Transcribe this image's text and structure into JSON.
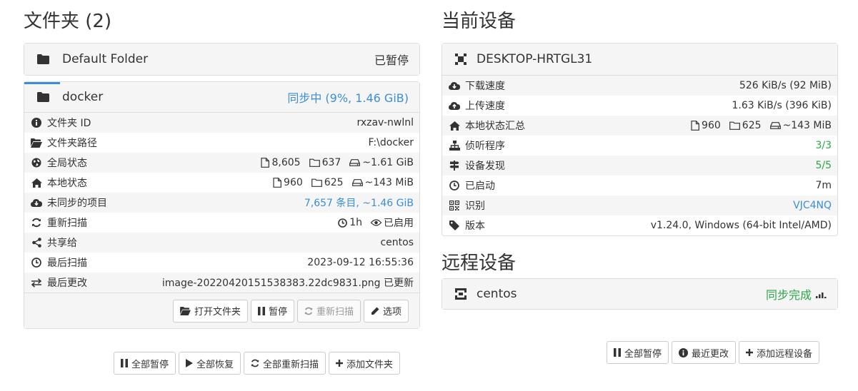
{
  "left": {
    "title": "文件夹 (2)",
    "folders": [
      {
        "name": "Default Folder",
        "status": "已暂停",
        "icon": "folder-icon"
      },
      {
        "name": "docker",
        "status": "同步中 (9%, 1.46 GiB)",
        "icon": "folder-icon",
        "progress_fraction": 0.09
      }
    ],
    "details": [
      {
        "icon": "info-icon",
        "label": "文件夹 ID",
        "value": "rxzav-nwlnl"
      },
      {
        "icon": "folder-open-icon",
        "label": "文件夹路径",
        "value": "F:\\docker"
      },
      {
        "icon": "globe-icon",
        "label": "全局状态",
        "files": "8,605",
        "dirs": "637",
        "size": "~1.61 GiB"
      },
      {
        "icon": "home-icon",
        "label": "本地状态",
        "files": "960",
        "dirs": "625",
        "size": "~143 MiB"
      },
      {
        "icon": "cloud-download-icon",
        "label": "未同步的项目",
        "value": "7,657 条目, ~1.46 GiB"
      },
      {
        "icon": "refresh-icon",
        "label": "重新扫描",
        "interval": "1h",
        "watch": "已启用"
      },
      {
        "icon": "share-icon",
        "label": "共享给",
        "value": "centos"
      },
      {
        "icon": "clock-icon",
        "label": "最后扫描",
        "value": "2023-09-12 16:55:36"
      },
      {
        "icon": "exchange-icon",
        "label": "最后更改",
        "value": "image-20220420151538383.22dc9831.png 已更新"
      }
    ],
    "footer_buttons": {
      "open": "打开文件夹",
      "pause": "暂停",
      "rescan": "重新扫描",
      "options": "选项"
    },
    "bottom_buttons": {
      "pause_all": "全部暂停",
      "resume_all": "全部恢复",
      "rescan_all": "全部重新扫描",
      "add_folder": "添加文件夹"
    }
  },
  "right": {
    "title": "当前设备",
    "device_name": "DESKTOP-HRTGL31",
    "details": [
      {
        "icon": "cloud-download-icon",
        "label": "下载速度",
        "value": "526 KiB/s (92 MiB)"
      },
      {
        "icon": "cloud-upload-icon",
        "label": "上传速度",
        "value": "1.63 KiB/s (396 KiB)"
      },
      {
        "icon": "home-icon",
        "label": "本地状态汇总",
        "files": "960",
        "dirs": "625",
        "size": "~143 MiB"
      },
      {
        "icon": "sitemap-icon",
        "label": "侦听程序",
        "value": "3/3"
      },
      {
        "icon": "signpost-icon",
        "label": "设备发现",
        "value": "5/5"
      },
      {
        "icon": "clock-icon",
        "label": "已启动",
        "value": "7m"
      },
      {
        "icon": "qrcode-icon",
        "label": "识别",
        "value": "VJC4NQ"
      },
      {
        "icon": "tag-icon",
        "label": "版本",
        "value": "v1.24.0, Windows (64-bit Intel/AMD)"
      }
    ],
    "remote_title": "远程设备",
    "remote_device": {
      "name": "centos",
      "status": "同步完成"
    },
    "bottom_buttons": {
      "pause_all": "全部暂停",
      "recent_changes": "最近更改",
      "add_device": "添加远程设备"
    }
  },
  "colors": {
    "accent_blue": "#3b8ed6",
    "success_green": "#2aa845",
    "panel_bg": "#f5f5f5",
    "border": "#dddddd"
  }
}
